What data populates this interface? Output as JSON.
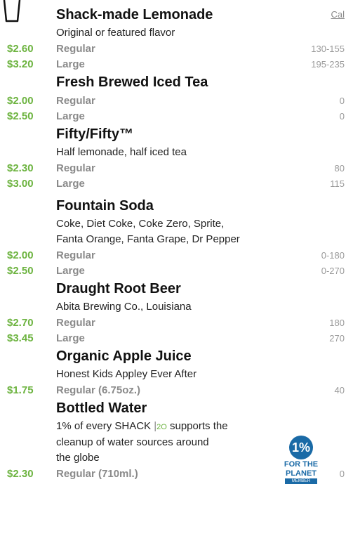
{
  "header": {
    "cal_label": "Cal"
  },
  "sections": [
    {
      "title": "Shack-made Lemonade",
      "desc": [
        "Original or featured flavor"
      ],
      "rows": [
        {
          "price": "$2.60",
          "size": "Regular",
          "cal": "130-155"
        },
        {
          "price": "$3.20",
          "size": "Large",
          "cal": "195-235"
        }
      ]
    },
    {
      "title": "Fresh Brewed Iced Tea",
      "desc": [],
      "rows": [
        {
          "price": "$2.00",
          "size": "Regular",
          "cal": "0"
        },
        {
          "price": "$2.50",
          "size": "Large",
          "cal": "0"
        }
      ]
    },
    {
      "title": "Fifty/Fifty™",
      "desc": [
        "Half lemonade, half iced tea"
      ],
      "rows": [
        {
          "price": "$2.30",
          "size": "Regular",
          "cal": "80"
        },
        {
          "price": "$3.00",
          "size": "Large",
          "cal": "115"
        }
      ]
    },
    {
      "title": "Fountain Soda",
      "desc": [
        "Coke, Diet Coke, Coke Zero, Sprite,",
        "Fanta Orange, Fanta Grape, Dr Pepper"
      ],
      "rows": [
        {
          "price": "$2.00",
          "size": "Regular",
          "cal": "0-180"
        },
        {
          "price": "$2.50",
          "size": "Large",
          "cal": "0-270"
        }
      ]
    },
    {
      "title": "Draught Root Beer",
      "desc": [
        "Abita Brewing Co., Louisiana"
      ],
      "rows": [
        {
          "price": "$2.70",
          "size": "Regular",
          "cal": "180"
        },
        {
          "price": "$3.45",
          "size": "Large",
          "cal": "270"
        }
      ]
    },
    {
      "title": "Organic Apple Juice",
      "desc": [
        "Honest Kids Appley Ever After"
      ],
      "rows": [
        {
          "price": "$1.75",
          "size": "Regular (6.75oz.)",
          "cal": "40"
        }
      ]
    }
  ],
  "bottled": {
    "title": "Bottled Water",
    "desc_line1_pre": "1% of every SHACK",
    "desc_line1_o2": "2O",
    "desc_line1_post": " supports the",
    "desc_line2": "cleanup of water sources around",
    "desc_line3": "the globe",
    "row": {
      "price": "$2.30",
      "size": "Regular (710ml.)",
      "cal": "0"
    }
  },
  "badge": {
    "number": "1%",
    "line1": "FOR THE",
    "line2": "PLANET",
    "sub": "MEMBER"
  }
}
